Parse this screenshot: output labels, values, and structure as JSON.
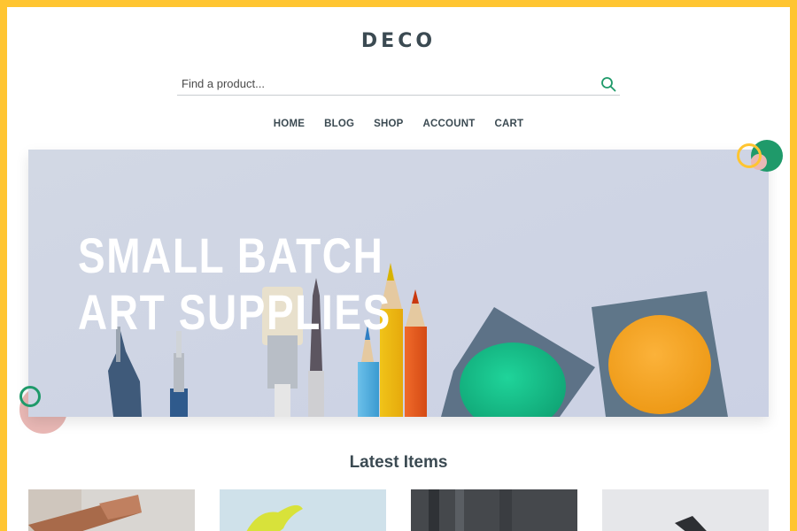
{
  "header": {
    "logo": "DECO"
  },
  "search": {
    "placeholder": "Find a product..."
  },
  "nav": {
    "items": [
      {
        "label": "HOME"
      },
      {
        "label": "BLOG"
      },
      {
        "label": "SHOP"
      },
      {
        "label": "ACCOUNT"
      },
      {
        "label": "CART"
      }
    ]
  },
  "hero": {
    "line1": "SMALL BATCH",
    "line2": "ART SUPPLIES"
  },
  "latest": {
    "title": "Latest Items"
  },
  "colors": {
    "accent": "#ffc531",
    "green": "#1f9a6a",
    "pink": "#e9b8b5",
    "text": "#3b4a52"
  }
}
